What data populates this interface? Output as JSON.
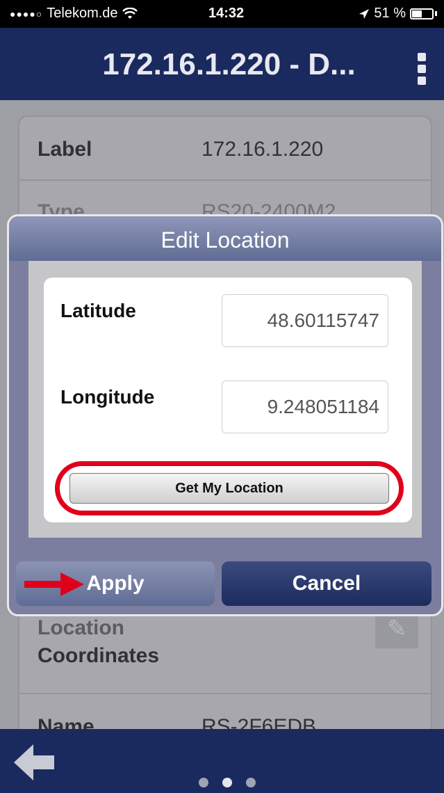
{
  "status_bar": {
    "carrier": "Telekom.de",
    "time": "14:32",
    "battery": "51 %",
    "battery_level": 0.51
  },
  "header": {
    "title": "172.16.1.220 - D..."
  },
  "detail_rows": [
    {
      "label": "Label",
      "value": "172.16.1.220"
    },
    {
      "label": "Type",
      "value": "RS20-2400M2"
    },
    {
      "label": "Location",
      "label2": "Coordinates",
      "value": ""
    },
    {
      "label": "Name",
      "value": "RS-2F6EDB"
    }
  ],
  "dialog": {
    "title": "Edit Location",
    "latitude_label": "Latitude",
    "latitude_value": "48.60115747",
    "longitude_label": "Longitude",
    "longitude_value": "9.248051184",
    "get_location_label": "Get My Location",
    "apply_label": "Apply",
    "cancel_label": "Cancel"
  },
  "colors": {
    "navy": "#1a2a5e",
    "highlight_red": "#e0001b"
  },
  "icons": [
    "wifi-icon",
    "location-arrow-icon",
    "battery-icon",
    "menu-icon",
    "back-arrow-icon",
    "pencil-icon",
    "red-arrow-icon"
  ],
  "page_indicator": {
    "count": 3,
    "active": 1
  }
}
